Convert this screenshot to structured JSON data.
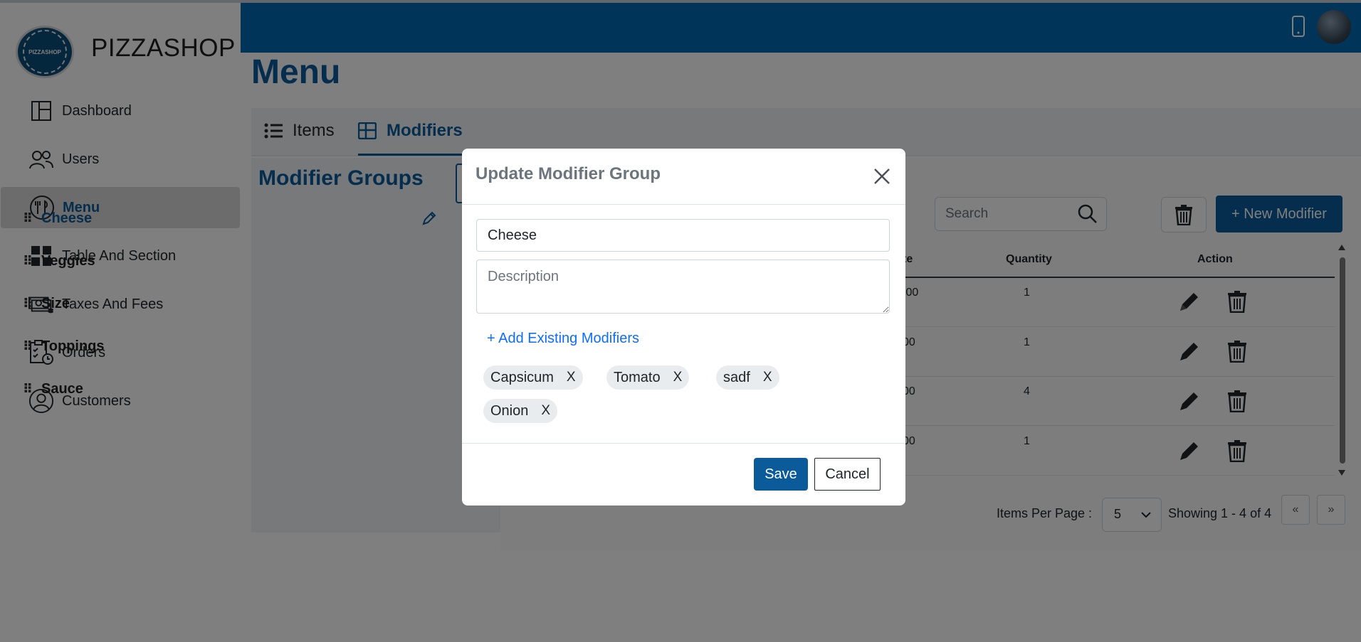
{
  "app": {
    "brand": "PIZZASHOP",
    "logo_text": "PIZZASHOP"
  },
  "sidebar": {
    "items": [
      {
        "label": "Dashboard",
        "icon": "dashboard-icon"
      },
      {
        "label": "Users",
        "icon": "users-icon"
      },
      {
        "label": "Menu",
        "icon": "menu-icon",
        "active": true
      },
      {
        "label": "Table And Section",
        "icon": "table-grid-icon"
      },
      {
        "label": "Taxes And Fees",
        "icon": "money-icon"
      },
      {
        "label": "Orders",
        "icon": "clipboard-clock-icon"
      },
      {
        "label": "Customers",
        "icon": "customer-icon"
      }
    ]
  },
  "page": {
    "title": "Menu"
  },
  "tabs": [
    {
      "label": "Items"
    },
    {
      "label": "Modifiers",
      "active": true
    }
  ],
  "groups": {
    "title": "Modifier Groups",
    "items": [
      "Cheese",
      "Veggies",
      "Size",
      "Toppings",
      "Sauce"
    ]
  },
  "modifiers": {
    "search_placeholder": "Search",
    "new_button": "+ New Modifier",
    "columns": {
      "rate_partial": "te",
      "quantity": "Quantity",
      "action": "Action"
    },
    "rows": [
      {
        "rate_partial": ".00",
        "quantity": "1"
      },
      {
        "rate_partial": "00",
        "quantity": "1"
      },
      {
        "rate_partial": "00",
        "quantity": "4"
      },
      {
        "rate_partial": "00",
        "quantity": "1"
      }
    ],
    "pager": {
      "per_page_label": "Items Per Page :",
      "per_page_value": "5",
      "showing": "Showing 1 - 4 of 4",
      "prev": "«",
      "next": "»"
    }
  },
  "modal": {
    "title": "Update Modifier Group",
    "name_value": "Cheese",
    "description_placeholder": "Description",
    "add_existing": "+ Add Existing Modifiers",
    "chips": [
      "Capsicum",
      "Tomato",
      "sadf",
      "Onion"
    ],
    "chip_remove": "X",
    "save": "Save",
    "cancel": "Cancel"
  },
  "colors": {
    "primary": "#0b5a9a",
    "header": "#0068b3",
    "link": "#0d6efd",
    "overlay": "rgba(0,0,0,0.5)"
  }
}
